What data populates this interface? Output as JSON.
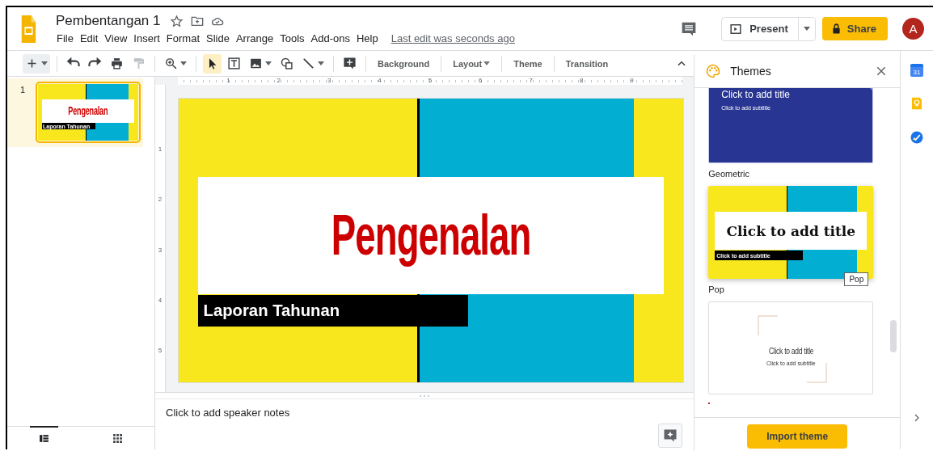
{
  "document": {
    "title": "Pembentangan 1"
  },
  "menu": [
    "File",
    "Edit",
    "View",
    "Insert",
    "Format",
    "Slide",
    "Arrange",
    "Tools",
    "Add-ons",
    "Help"
  ],
  "last_edit": "Last edit was seconds ago",
  "header_actions": {
    "present": "Present",
    "share": "Share",
    "avatar": "A"
  },
  "toolbar": {
    "tools": [
      {
        "selected": false
      },
      {
        "selected": false
      },
      {
        "selected": false
      },
      {
        "selected": false
      },
      {
        "selected": false
      },
      {
        "selected": false
      },
      {
        "selected": true
      },
      {
        "selected": false
      },
      {
        "selected": false
      },
      {
        "selected": false
      },
      {
        "selected": false
      },
      {
        "selected": false
      }
    ],
    "buttons": [
      {
        "label": "Background",
        "dropdown": false
      },
      {
        "label": "Layout",
        "dropdown": true
      },
      {
        "label": "Theme",
        "dropdown": false
      },
      {
        "label": "Transition",
        "dropdown": false
      }
    ]
  },
  "filmstrip": {
    "slides": [
      {
        "number": "1",
        "selected": true,
        "title": "Pengenalan",
        "subtitle": "Laporan Tahunan"
      }
    ],
    "views": [
      {
        "selected": true
      },
      {
        "selected": false
      }
    ]
  },
  "horizontal_ruler": [
    "1",
    "2",
    "3",
    "4",
    "5",
    "6",
    "7",
    "8",
    "9"
  ],
  "vertical_ruler": [
    "1",
    "2",
    "3",
    "4",
    "5"
  ],
  "slide": {
    "title": "Pengenalan",
    "subtitle": "Laporan Tahunan"
  },
  "notes": {
    "placeholder": "Click to add speaker notes"
  },
  "themes_panel": {
    "title": "Themes",
    "themes": [
      {
        "kind": "blue",
        "title": "Click to add title",
        "subtitle": "Click to add subtitle",
        "name": "Geometric"
      },
      {
        "kind": "pop",
        "title": "Click to add title",
        "subtitle": "Click to add subtitle",
        "name": "Pop",
        "tooltip": "Pop"
      },
      {
        "kind": "minimal",
        "title": "Click to add title",
        "subtitle": "Click to add subtitle"
      }
    ],
    "import_button": "Import theme"
  },
  "side_apps": {
    "calendar_day": "31"
  }
}
